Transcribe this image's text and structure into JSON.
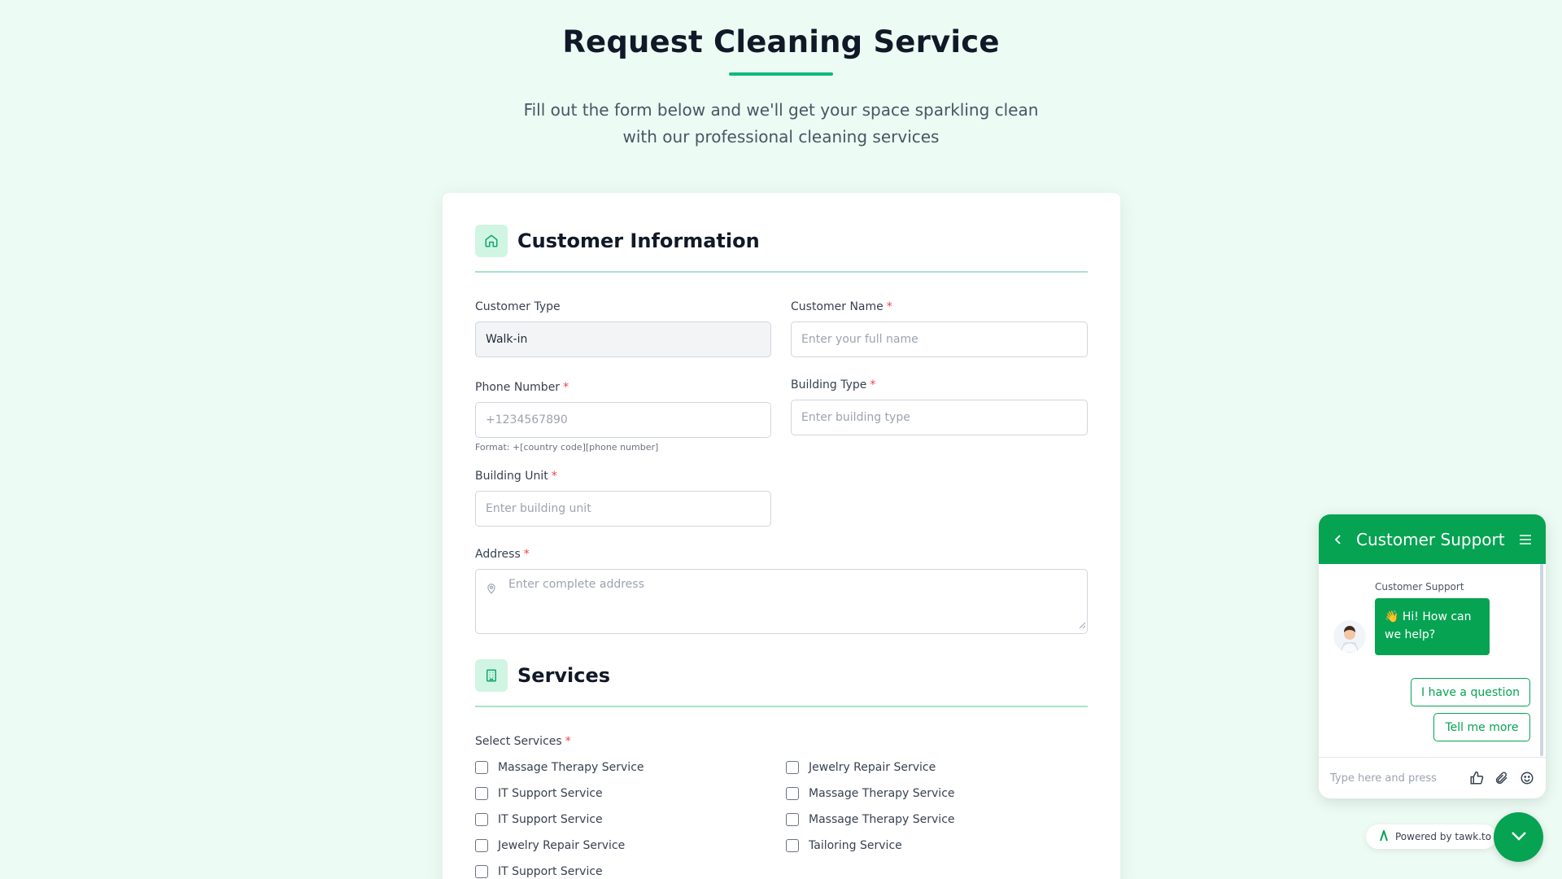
{
  "page": {
    "title": "Request Cleaning Service",
    "subtitle": "Fill out the form below and we'll get your space sparkling clean with our professional cleaning services"
  },
  "customer_section": {
    "title": "Customer Information",
    "icon": "home-icon",
    "customer_type": {
      "label": "Customer Type",
      "value": "Walk-in"
    },
    "customer_name": {
      "label": "Customer Name",
      "required": "*",
      "placeholder": "Enter your full name"
    },
    "phone": {
      "label": "Phone Number",
      "required": "*",
      "placeholder": "+1234567890",
      "hint": "Format: +[country code][phone number]"
    },
    "building_type": {
      "label": "Building Type",
      "required": "*",
      "placeholder": "Enter building type"
    },
    "building_unit": {
      "label": "Building Unit",
      "required": "*",
      "placeholder": "Enter building unit"
    },
    "address": {
      "label": "Address",
      "required": "*",
      "placeholder": "Enter complete address"
    }
  },
  "services_section": {
    "title": "Services",
    "icon": "building-icon",
    "select_label": "Select Services",
    "required": "*",
    "left_column": [
      "Massage Therapy Service",
      "IT Support Service",
      "IT Support Service",
      "Jewelry Repair Service",
      "IT Support Service"
    ],
    "right_column": [
      "Jewelry Repair Service",
      "Massage Therapy Service",
      "Massage Therapy Service",
      "Tailoring Service"
    ]
  },
  "chat": {
    "title": "Customer Support",
    "agent_name": "Customer Support",
    "message": "👋 Hi! How can we help?",
    "quick_replies": [
      "I have a question",
      "Tell me more"
    ],
    "input_placeholder": "Type here and press",
    "powered_by": "Powered by tawk.to",
    "accent": "#06a352"
  },
  "colors": {
    "background": "#ecfbf3",
    "accent": "#10b981",
    "required": "#ef4444"
  }
}
